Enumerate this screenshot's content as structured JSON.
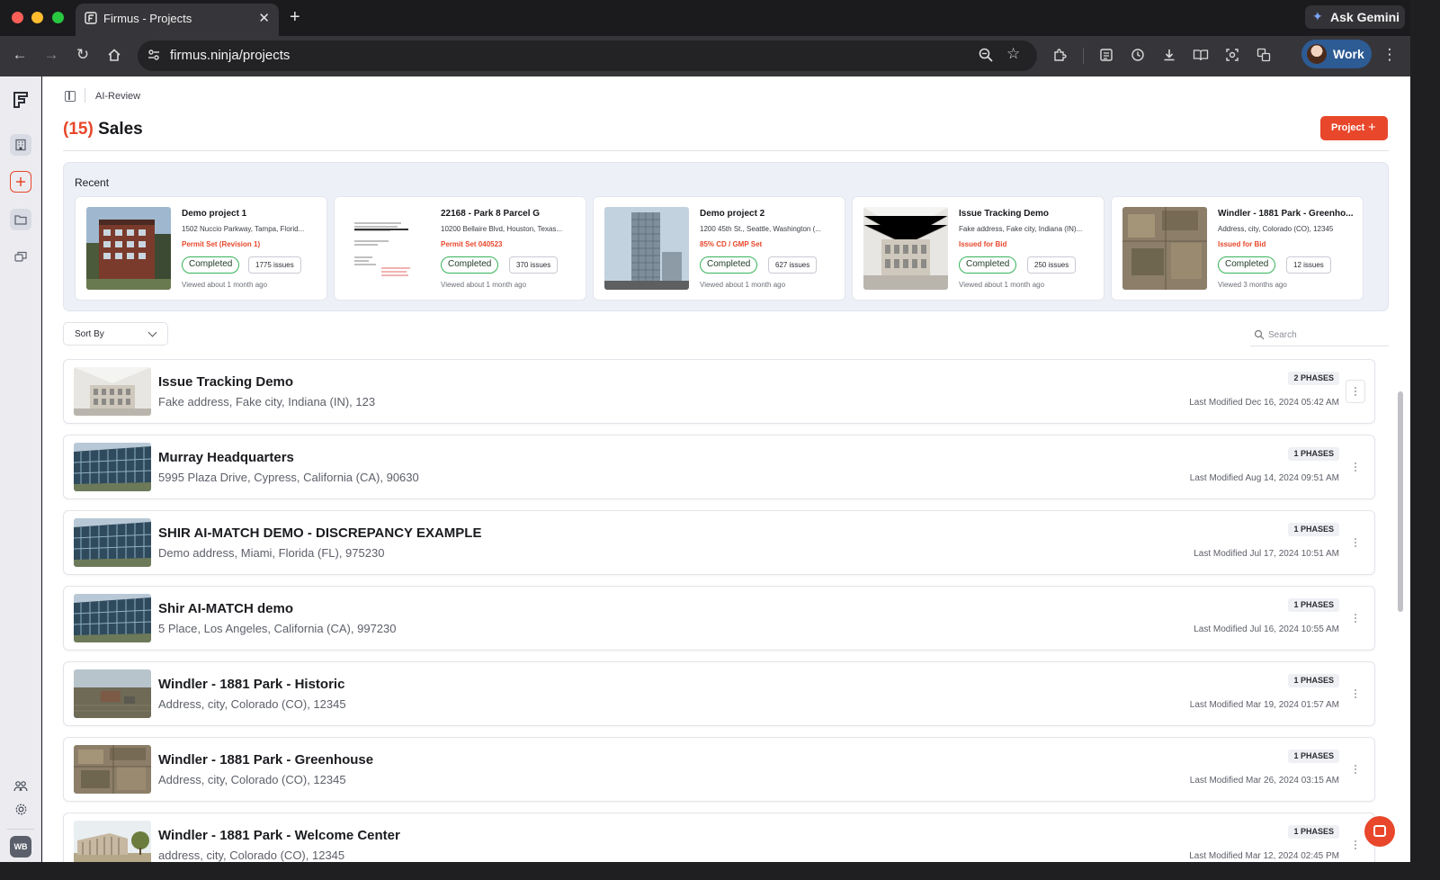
{
  "browser": {
    "tab_title": "Firmus - Projects",
    "tab_close": "✕",
    "new_tab": "+",
    "gemini_label": "Ask Gemini",
    "url": "firmus.ninja/projects",
    "profile_label": "Work"
  },
  "sidebar": {
    "avatar_initials": "WB"
  },
  "breadcrumb": {
    "label": "AI-Review"
  },
  "header": {
    "count": "(15)",
    "title": "Sales",
    "new_project_label": "Project",
    "new_project_plus": "+"
  },
  "recent": {
    "heading": "Recent",
    "items": [
      {
        "name": "Demo project 1",
        "address": "1502 Nuccio Parkway, Tampa, Florid...",
        "phase": "Permit Set (Revision 1)",
        "status": "Completed",
        "issues": "1775 issues",
        "viewed": "Viewed about 1 month ago"
      },
      {
        "name": "22168 - Park 8 Parcel G",
        "address": "10200 Bellaire Blvd, Houston, Texas...",
        "phase": "Permit Set 040523",
        "status": "Completed",
        "issues": "370 issues",
        "viewed": "Viewed about 1 month ago"
      },
      {
        "name": "Demo project 2",
        "address": "1200 45th St., Seattle, Washington (...",
        "phase": "85% CD / GMP Set",
        "status": "Completed",
        "issues": "627 issues",
        "viewed": "Viewed about 1 month ago"
      },
      {
        "name": "Issue Tracking Demo",
        "address": "Fake address, Fake city, Indiana (IN)...",
        "phase": "Issued for Bid",
        "status": "Completed",
        "issues": "250 issues",
        "viewed": "Viewed about 1 month ago"
      },
      {
        "name": "Windler - 1881 Park - Greenho...",
        "address": "Address, city, Colorado (CO), 12345",
        "phase": "Issued for Bid",
        "status": "Completed",
        "issues": "12 issues",
        "viewed": "Viewed 3 months ago"
      }
    ]
  },
  "controls": {
    "sort_label": "Sort By",
    "search_placeholder": "Search"
  },
  "projects": [
    {
      "name": "Issue Tracking Demo",
      "address": "Fake address, Fake city, Indiana (IN), 123",
      "phases": "2 PHASES",
      "modified": "Last Modified Dec 16, 2024 05:42 AM"
    },
    {
      "name": "Murray Headquarters",
      "address": "5995 Plaza Drive, Cypress, California (CA), 90630",
      "phases": "1 PHASES",
      "modified": "Last Modified Aug 14, 2024 09:51 AM"
    },
    {
      "name": "SHIR AI-MATCH DEMO - DISCREPANCY EXAMPLE",
      "address": "Demo address, Miami, Florida (FL), 975230",
      "phases": "1 PHASES",
      "modified": "Last Modified Jul 17, 2024 10:51 AM"
    },
    {
      "name": "Shir AI-MATCH demo",
      "address": "5 Place, Los Angeles, California (CA), 997230",
      "phases": "1 PHASES",
      "modified": "Last Modified Jul 16, 2024 10:55 AM"
    },
    {
      "name": "Windler - 1881 Park - Historic",
      "address": "Address, city, Colorado (CO), 12345",
      "phases": "1 PHASES",
      "modified": "Last Modified Mar 19, 2024 01:57 AM"
    },
    {
      "name": "Windler - 1881 Park - Greenhouse",
      "address": "Address, city, Colorado (CO), 12345",
      "phases": "1 PHASES",
      "modified": "Last Modified Mar 26, 2024 03:15 AM"
    },
    {
      "name": "Windler - 1881 Park - Welcome Center",
      "address": "address, city, Colorado (CO), 12345",
      "phases": "1 PHASES",
      "modified": "Last Modified Mar 12, 2024 02:45 PM"
    }
  ],
  "colors": {
    "accent": "#e8472b",
    "status_green": "#37b35a",
    "chrome_dark": "#1b1b1d",
    "chrome_toolbar": "#36363a"
  }
}
